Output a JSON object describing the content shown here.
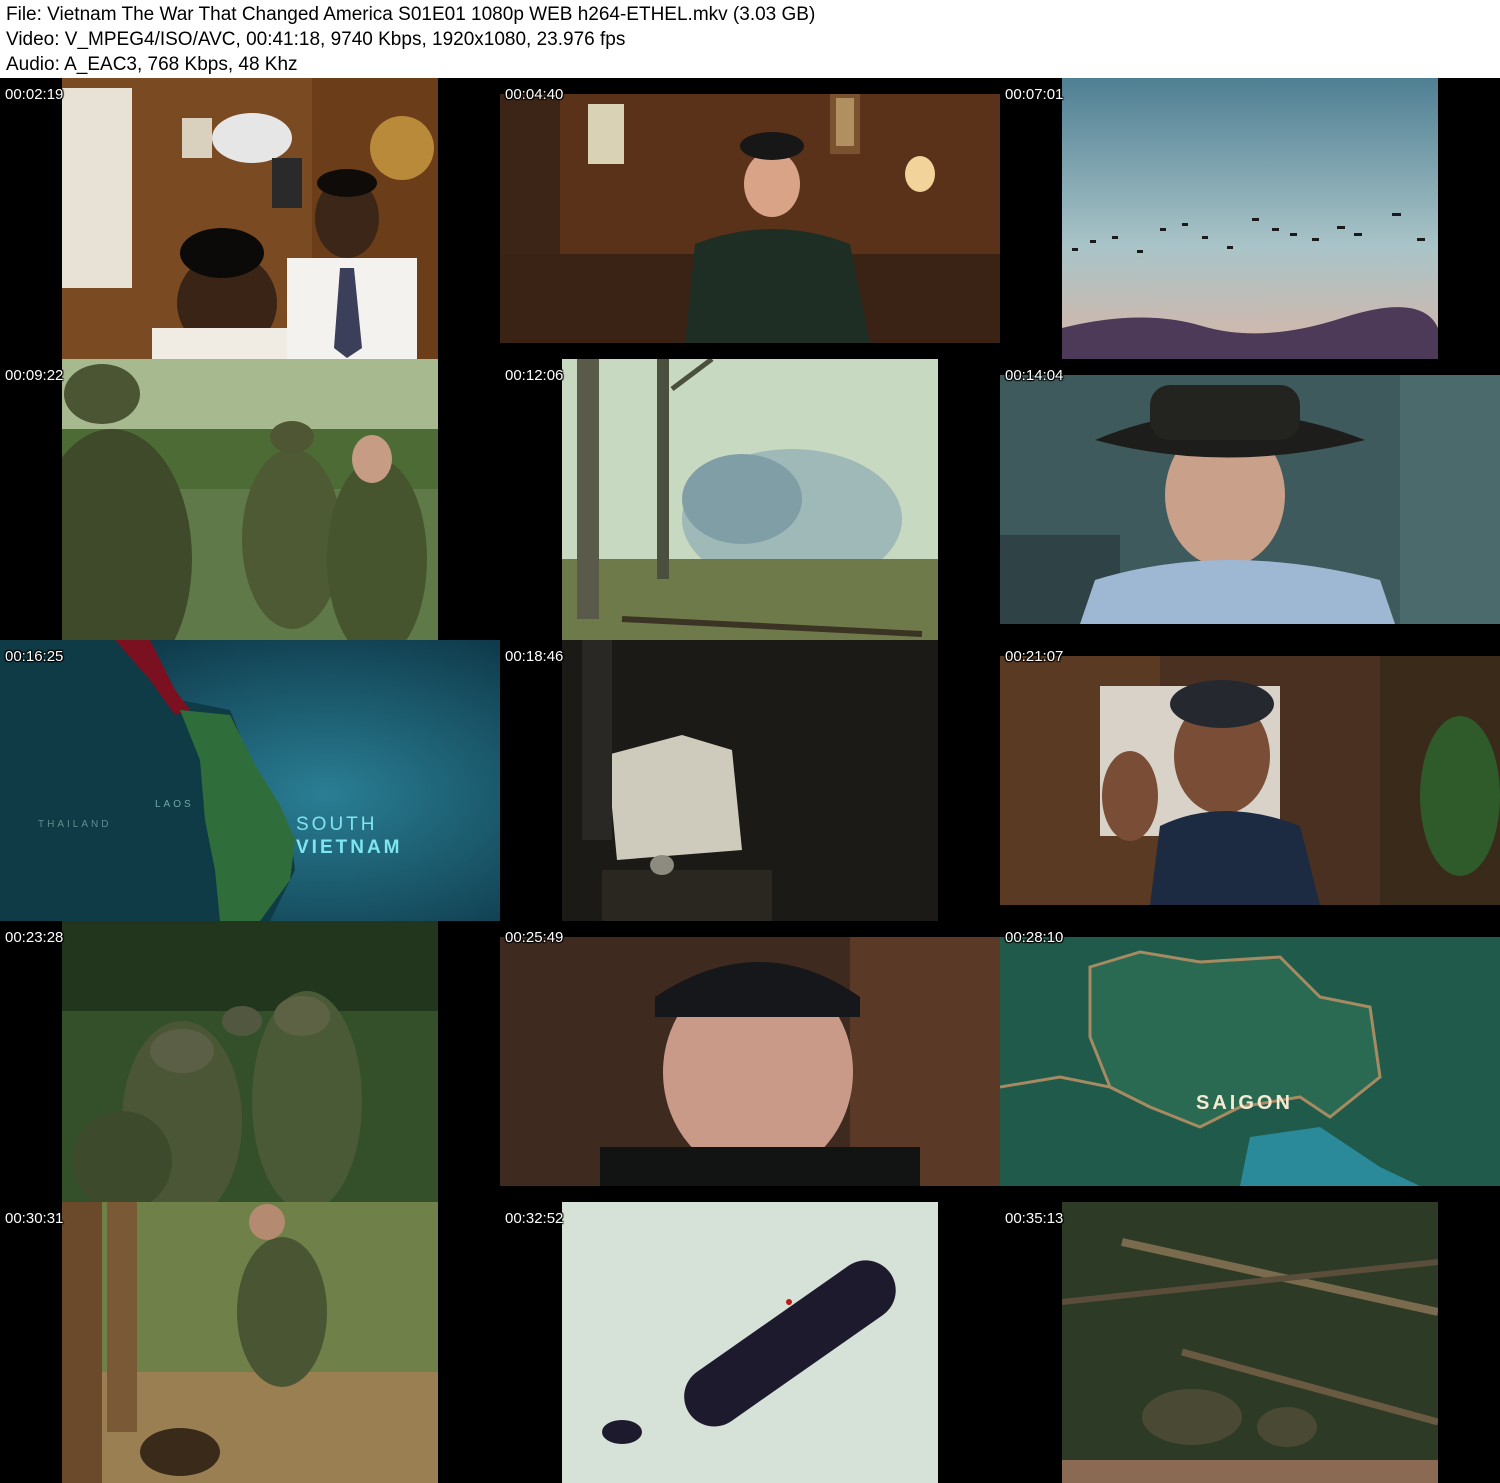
{
  "header": {
    "file_line": "File: Vietnam The War That Changed America S01E01 1080p WEB h264-ETHEL.mkv (3.03 GB)",
    "video_line": "Video: V_MPEG4/ISO/AVC, 00:41:18, 9740 Kbps, 1920x1080, 23.976 fps",
    "audio_line": "Audio: A_EAC3, 768 Kbps, 48 Khz"
  },
  "thumbnails": [
    {
      "timestamp": "00:02:19"
    },
    {
      "timestamp": "00:04:40"
    },
    {
      "timestamp": "00:07:01"
    },
    {
      "timestamp": "00:09:22"
    },
    {
      "timestamp": "00:12:06"
    },
    {
      "timestamp": "00:14:04"
    },
    {
      "timestamp": "00:16:25",
      "map_labels": {
        "region": "SOUTH",
        "region2": "VIETNAM",
        "country1": "LAOS",
        "country2": "THAILAND"
      }
    },
    {
      "timestamp": "00:18:46"
    },
    {
      "timestamp": "00:21:07"
    },
    {
      "timestamp": "00:23:28"
    },
    {
      "timestamp": "00:25:49"
    },
    {
      "timestamp": "00:28:10",
      "map_labels": {
        "city": "SAIGON"
      }
    },
    {
      "timestamp": "00:30:31"
    },
    {
      "timestamp": "00:32:52"
    },
    {
      "timestamp": "00:35:13"
    }
  ]
}
